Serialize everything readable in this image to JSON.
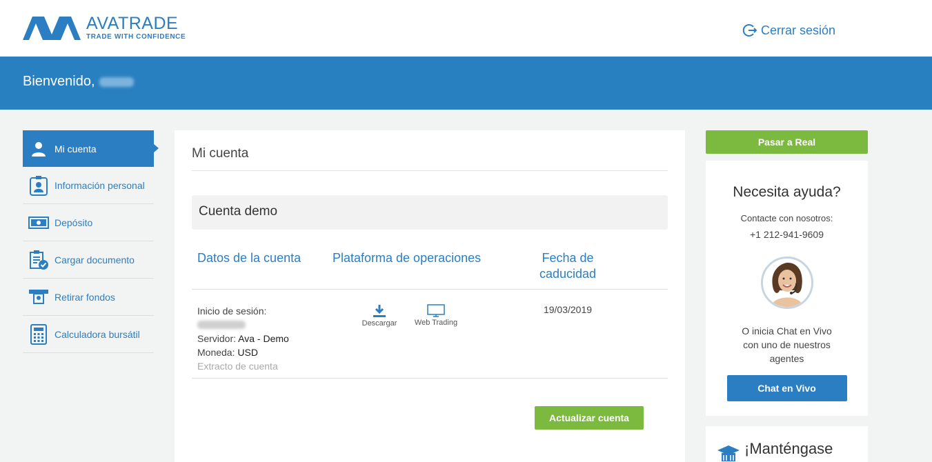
{
  "header": {
    "logo_main": "AVATRADE",
    "logo_tagline": "TRADE WITH CONFIDENCE",
    "logout_label": "Cerrar sesión"
  },
  "banner": {
    "welcome": "Bienvenido,"
  },
  "sidebar": {
    "items": [
      {
        "label": "Mi cuenta",
        "icon": "user-icon",
        "active": true
      },
      {
        "label": "Información personal",
        "icon": "id-badge-icon"
      },
      {
        "label": "Depósito",
        "icon": "banknote-icon"
      },
      {
        "label": "Cargar documento",
        "icon": "clipboard-check-icon"
      },
      {
        "label": "Retirar fondos",
        "icon": "withdraw-icon"
      },
      {
        "label": "Calculadora bursátil",
        "icon": "calculator-icon"
      }
    ]
  },
  "main": {
    "title": "Mi cuenta",
    "demo_title": "Cuenta demo",
    "columns": {
      "account": "Datos de la cuenta",
      "platform": "Plataforma de operaciones",
      "expiry": "Fecha de caducidad"
    },
    "account": {
      "login_label": "Inicio de sesión:",
      "server_label": "Servidor:",
      "server_value": "Ava - Demo",
      "currency_label": "Moneda:",
      "currency_value": "USD",
      "statement_link": "Extracto de cuenta"
    },
    "platforms": {
      "download": "Descargar",
      "web": "Web Trading"
    },
    "expiry_date": "19/03/2019",
    "update_button": "Actualizar cuenta"
  },
  "right": {
    "real_button": "Pasar a Real",
    "help_title": "Necesita ayuda?",
    "contact_label": "Contacte con nosotros:",
    "phone": "+1 212-941-9609",
    "chat_text": "O inicia Chat en Vivo con uno de nuestros agentes",
    "chat_button": "Chat en Vivo",
    "stay_title": "¡Manténgase"
  },
  "colors": {
    "primary": "#2b7ec1",
    "banner": "#2980c1",
    "green": "#7cba3f",
    "bg": "#f2f3f3"
  }
}
